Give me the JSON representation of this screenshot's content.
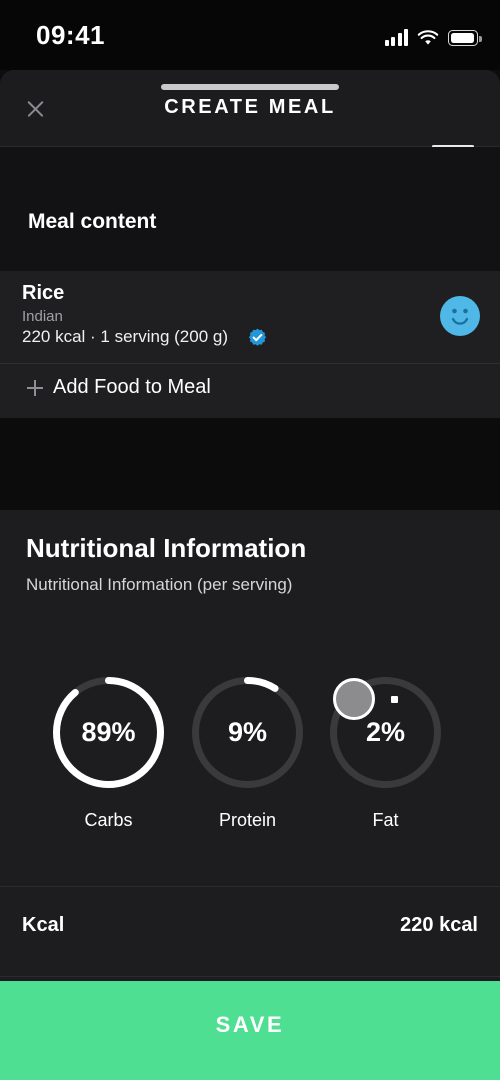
{
  "status_bar": {
    "time": "09:41",
    "signal_icon": "cellular-bars-icon",
    "wifi_icon": "wifi-icon",
    "battery_icon": "battery-icon",
    "battery_level_pct": 82
  },
  "header": {
    "title": "CREATE MEAL",
    "close_icon": "close-icon",
    "scroll_indicator": "scroll-indicator"
  },
  "meal_content": {
    "section_title": "Meal content",
    "food": {
      "name": "Rice",
      "brand": "Indian",
      "meta": "220 kcal · 1 serving (200 g)",
      "verified_icon": "verified-badge-icon",
      "rating_icon": "smiley-face-icon",
      "rating_color": "#4fb8e6"
    },
    "add_food_label": "Add Food to Meal",
    "add_food_icon": "plus-icon"
  },
  "nutrition": {
    "title": "Nutritional Information",
    "subtitle": "Nutritional Information (per serving)",
    "kcal_row": {
      "label": "Kcal",
      "value": "220 kcal"
    }
  },
  "chart_data": {
    "type": "pie",
    "title": "Nutritional Information (per serving)",
    "subtype": "donut-gauges",
    "legend_position": "below-each",
    "categories": [
      "Carbs",
      "Protein",
      "Fat"
    ],
    "values": [
      89,
      9,
      2
    ],
    "value_labels": [
      "89%",
      "9%",
      "2%"
    ],
    "unit": "%",
    "ylim": [
      0,
      100
    ],
    "grid": false,
    "track_color": "#3a3a3d",
    "arc_color": "#ffffff",
    "series": [
      {
        "name": "Carbs",
        "value": 89,
        "label": "89%",
        "arc_start_deg": 0,
        "arc_sweep_deg": 320
      },
      {
        "name": "Protein",
        "value": 9,
        "label": "9%",
        "arc_start_deg": 0,
        "arc_sweep_deg": 32
      },
      {
        "name": "Fat",
        "value": 2,
        "label": "2%",
        "arc_start_deg": 0,
        "arc_sweep_deg": 7,
        "handle": "drag-knob",
        "handle_color": "#8c8c8e"
      }
    ]
  },
  "footer": {
    "save_label": "SAVE",
    "save_color": "#4fdf92",
    "home_indicator": "home-indicator"
  }
}
